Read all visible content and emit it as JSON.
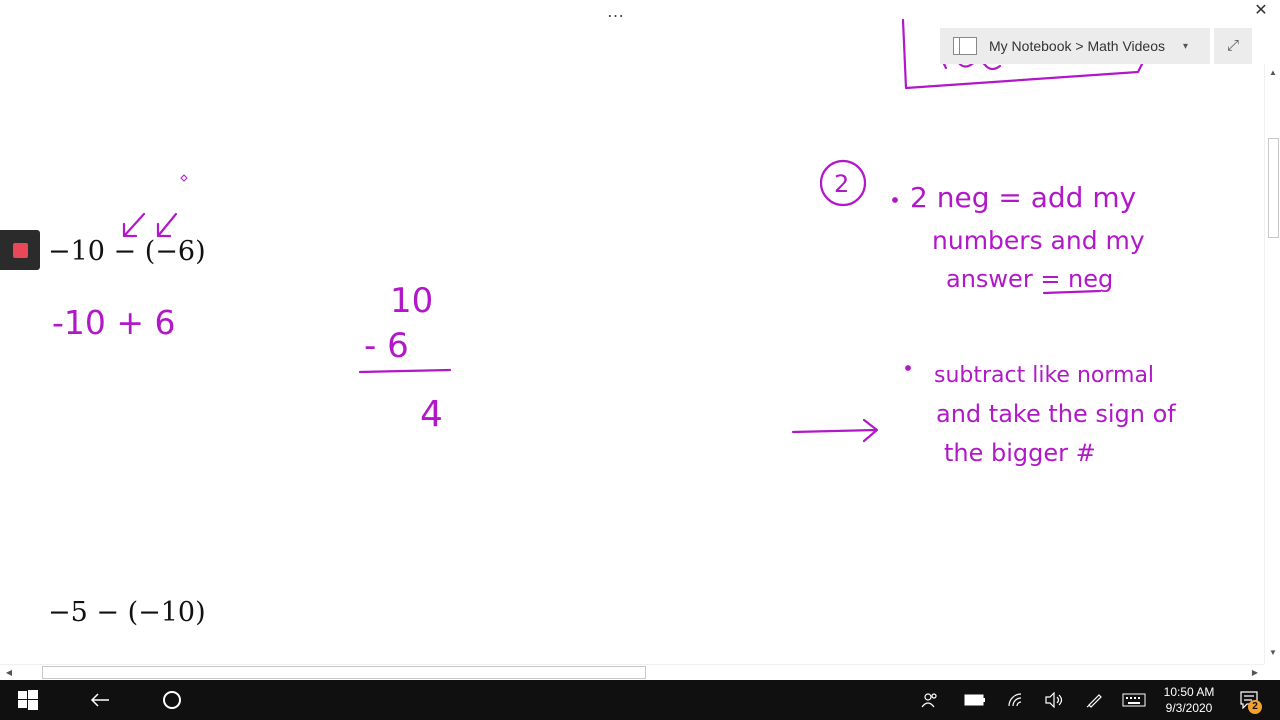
{
  "title_bar": {
    "more_label": "…",
    "close_label": "✕"
  },
  "notebook_picker": {
    "path": "My Notebook > Math Videos",
    "caret": "▾",
    "expand_label": "⤢"
  },
  "canvas": {
    "typed_equations": [
      "−10 − (−6)",
      "−5 − (−10)"
    ],
    "handwritten": {
      "rewrite": "-10 + 6",
      "vertical_top": "10",
      "vertical_bottom": "- 6",
      "vertical_result": "4",
      "rule_number": "2",
      "rule_1_lines": [
        "2 neg = add my",
        "numbers and my",
        "answer = neg"
      ],
      "rule_2_lines": [
        "subtract like normal",
        "and take the sign of",
        "the bigger #"
      ]
    },
    "ink_color": "#b118c8"
  },
  "record_button": {
    "color": "#e8485a"
  },
  "taskbar": {
    "time": "10:50 AM",
    "date": "9/3/2020",
    "notification_count": "2"
  }
}
